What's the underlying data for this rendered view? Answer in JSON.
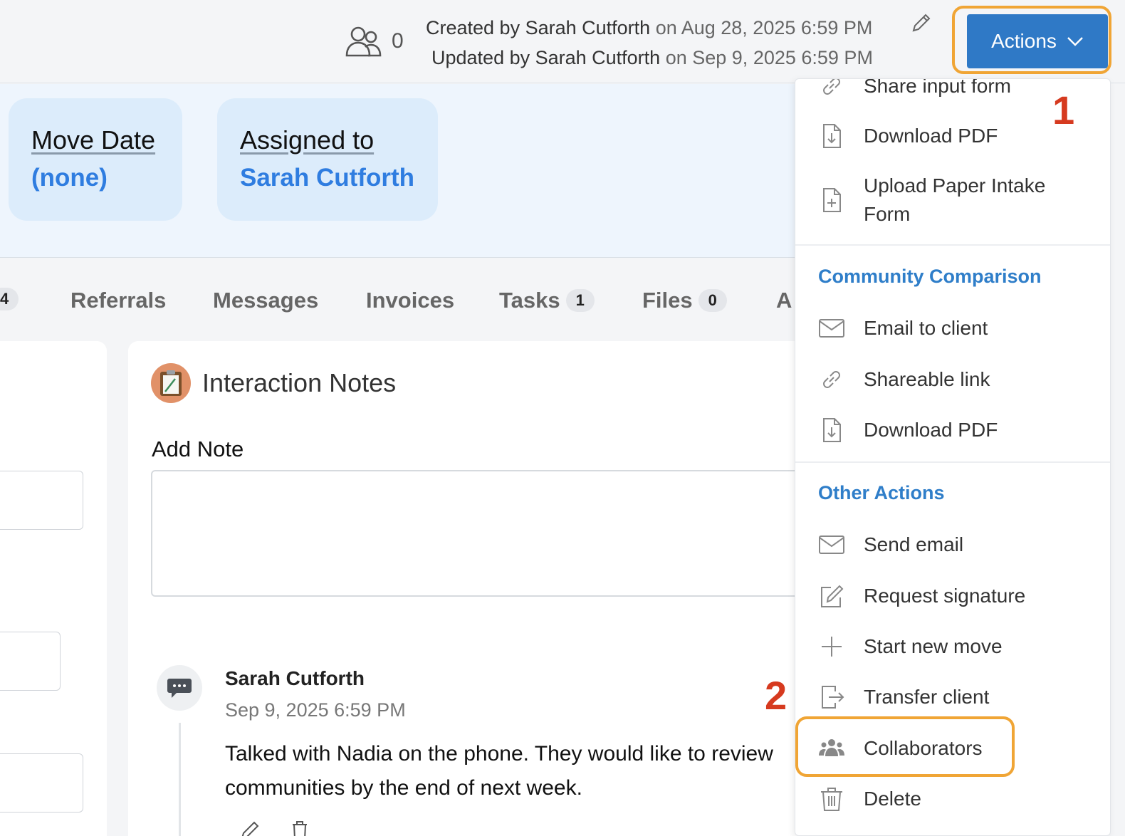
{
  "header": {
    "collaborator_count": "0",
    "created_by_label": "Created by Sarah Cutforth",
    "created_on": "on Aug 28, 2025 6:59 PM",
    "updated_by_label": "Updated by Sarah Cutforth",
    "updated_on": "on Sep 9, 2025 6:59 PM",
    "actions_label": "Actions"
  },
  "summary": {
    "move_date_label": "Move Date",
    "move_date_value": "(none)",
    "assigned_label": "Assigned to",
    "assigned_value": "Sarah Cutforth"
  },
  "tabs": [
    {
      "label": "",
      "badge": "4"
    },
    {
      "label": "Referrals"
    },
    {
      "label": "Messages"
    },
    {
      "label": "Invoices"
    },
    {
      "label": "Tasks",
      "badge": "1"
    },
    {
      "label": "Files",
      "badge": "0"
    },
    {
      "label": "A"
    }
  ],
  "notes": {
    "title": "Interaction Notes",
    "add_note_label": "Add Note",
    "entry": {
      "author": "Sarah Cutforth",
      "date": "Sep 9, 2025 6:59 PM",
      "text": "Talked with Nadia on the phone. They would like to review communities by the end of next week."
    }
  },
  "menu": {
    "items_top": [
      {
        "label": "Share input form",
        "icon": "link-icon"
      },
      {
        "label": "Download PDF",
        "icon": "file-download-icon"
      },
      {
        "label": "Upload Paper Intake Form",
        "icon": "file-plus-icon"
      }
    ],
    "community_section": "Community Comparison",
    "community_items": [
      {
        "label": "Email to client",
        "icon": "envelope-icon"
      },
      {
        "label": "Shareable link",
        "icon": "link-icon"
      },
      {
        "label": "Download PDF",
        "icon": "file-download-icon"
      }
    ],
    "other_section": "Other Actions",
    "other_items": [
      {
        "label": "Send email",
        "icon": "envelope-icon"
      },
      {
        "label": "Request signature",
        "icon": "pencil-square-icon"
      },
      {
        "label": "Start new move",
        "icon": "plus-icon"
      },
      {
        "label": "Transfer client",
        "icon": "exit-icon"
      },
      {
        "label": "Collaborators",
        "icon": "users-icon"
      },
      {
        "label": "Delete",
        "icon": "trash-icon"
      }
    ]
  },
  "annotations": {
    "step1": "1",
    "step2": "2"
  },
  "colors": {
    "accent": "#2f79c6",
    "highlight": "#f0a535",
    "annotation": "#d63a1f",
    "section": "#2f7ec9"
  }
}
